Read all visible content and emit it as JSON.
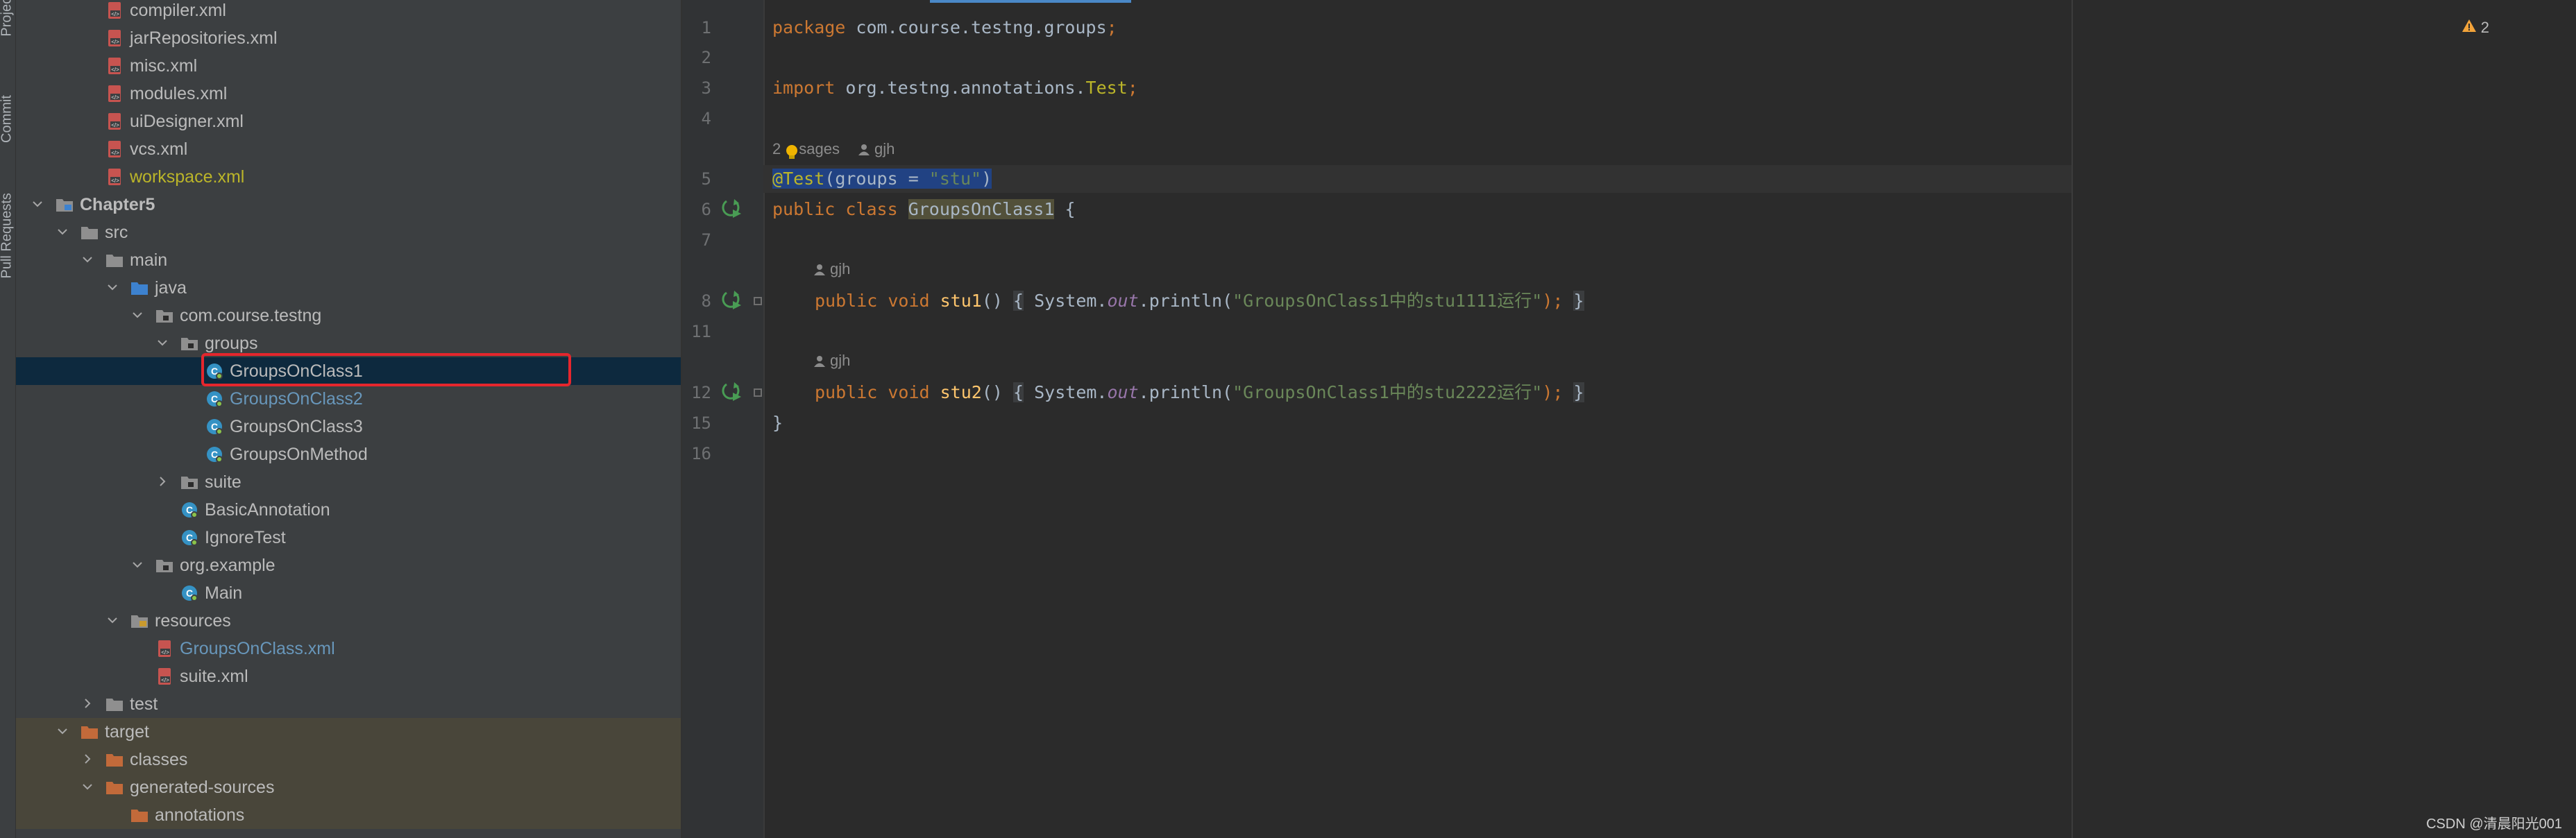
{
  "tool_strip": {
    "items": [
      {
        "label": "Project"
      },
      {
        "label": "Commit"
      },
      {
        "label": "Pull Requests"
      }
    ]
  },
  "project_tree": {
    "rows": [
      {
        "label": "compiler.xml",
        "depth": 3,
        "icon": "xml-file-icon",
        "state": "none"
      },
      {
        "label": "jarRepositories.xml",
        "depth": 3,
        "icon": "xml-file-icon",
        "state": "none"
      },
      {
        "label": "misc.xml",
        "depth": 3,
        "icon": "xml-file-icon",
        "state": "none"
      },
      {
        "label": "modules.xml",
        "depth": 3,
        "icon": "xml-file-icon",
        "state": "none"
      },
      {
        "label": "uiDesigner.xml",
        "depth": 3,
        "icon": "xml-file-icon",
        "state": "none"
      },
      {
        "label": "vcs.xml",
        "depth": 3,
        "icon": "xml-file-icon",
        "state": "none"
      },
      {
        "label": "workspace.xml",
        "depth": 3,
        "icon": "xml-file-icon",
        "state": "none",
        "tone": "gold"
      },
      {
        "label": "Chapter5",
        "depth": 1,
        "icon": "module-folder-icon",
        "state": "open",
        "bold": true
      },
      {
        "label": "src",
        "depth": 2,
        "icon": "folder-icon",
        "state": "open"
      },
      {
        "label": "main",
        "depth": 3,
        "icon": "folder-icon",
        "state": "open"
      },
      {
        "label": "java",
        "depth": 4,
        "icon": "source-folder-icon",
        "state": "open"
      },
      {
        "label": "com.course.testng",
        "depth": 5,
        "icon": "package-icon",
        "state": "open"
      },
      {
        "label": "groups",
        "depth": 6,
        "icon": "package-icon",
        "state": "open"
      },
      {
        "label": "GroupsOnClass1",
        "depth": 7,
        "icon": "java-class-icon",
        "state": "none",
        "selected": true
      },
      {
        "label": "GroupsOnClass2",
        "depth": 7,
        "icon": "java-class-icon",
        "state": "none",
        "tone": "blue"
      },
      {
        "label": "GroupsOnClass3",
        "depth": 7,
        "icon": "java-class-icon",
        "state": "none"
      },
      {
        "label": "GroupsOnMethod",
        "depth": 7,
        "icon": "java-class-icon",
        "state": "none"
      },
      {
        "label": "suite",
        "depth": 6,
        "icon": "package-icon",
        "state": "closed"
      },
      {
        "label": "BasicAnnotation",
        "depth": 6,
        "icon": "java-class-icon",
        "state": "none"
      },
      {
        "label": "IgnoreTest",
        "depth": 6,
        "icon": "java-class-icon",
        "state": "none"
      },
      {
        "label": "org.example",
        "depth": 5,
        "icon": "package-icon",
        "state": "open"
      },
      {
        "label": "Main",
        "depth": 6,
        "icon": "java-class-icon",
        "state": "none"
      },
      {
        "label": "resources",
        "depth": 4,
        "icon": "resources-folder-icon",
        "state": "open"
      },
      {
        "label": "GroupsOnClass.xml",
        "depth": 5,
        "icon": "xml-file-icon",
        "state": "none",
        "tone": "blue"
      },
      {
        "label": "suite.xml",
        "depth": 5,
        "icon": "xml-file-icon",
        "state": "none"
      },
      {
        "label": "test",
        "depth": 3,
        "icon": "folder-icon",
        "state": "closed"
      },
      {
        "label": "target",
        "depth": 2,
        "icon": "excluded-folder-icon",
        "state": "open",
        "excluded": true
      },
      {
        "label": "classes",
        "depth": 3,
        "icon": "excluded-folder-icon",
        "state": "closed",
        "excluded": true
      },
      {
        "label": "generated-sources",
        "depth": 3,
        "icon": "excluded-folder-icon",
        "state": "open",
        "excluded": true
      },
      {
        "label": "annotations",
        "depth": 4,
        "icon": "excluded-folder-icon",
        "state": "none",
        "excluded": true
      }
    ]
  },
  "editor": {
    "line1": {
      "num": "1",
      "kw": "package",
      "pkg": " com.course.testng.groups",
      "semi": ";"
    },
    "line2": {
      "num": "2"
    },
    "line3": {
      "num": "3",
      "kw": "import",
      "pkg": " org.testng.annotations.",
      "ann": "Test",
      "semi": ";"
    },
    "line4": {
      "num": "4"
    },
    "usages": {
      "count_prefix": "2",
      "count_suffix": "sages",
      "author": "gjh"
    },
    "line5": {
      "num": "5",
      "at": "@",
      "ann_name": "Test",
      "open": "(groups = ",
      "str": "\"stu\"",
      "close": ")"
    },
    "line6": {
      "num": "6",
      "kw1": "public",
      "kw2": " class ",
      "cls": "GroupsOnClass1",
      "rest": " {"
    },
    "line7": {
      "num": "7"
    },
    "author_hint1": "gjh",
    "line8": {
      "num": "8",
      "kw1": "public",
      "kw2": " void ",
      "fn": "stu1",
      "paren": "()",
      "lb": "{",
      "sys": " System.",
      "out": "out",
      "call": ".println(",
      "str": "\"GroupsOnClass1中的stu1111运行\"",
      "end": ");",
      "rb": "}"
    },
    "line11": {
      "num": "11"
    },
    "author_hint2": "gjh",
    "line12": {
      "num": "12",
      "kw1": "public",
      "kw2": " void ",
      "fn": "stu2",
      "paren": "()",
      "lb": "{",
      "sys": " System.",
      "out": "out",
      "call": ".println(",
      "str": "\"GroupsOnClass1中的stu2222运行\"",
      "end": ");",
      "rb": "}"
    },
    "line15": {
      "num": "15",
      "text": "}"
    },
    "line16": {
      "num": "16"
    },
    "warnings": "2"
  },
  "watermark": "CSDN @清晨阳光001",
  "colors": {
    "accent": "#e5262d",
    "selection": "#0d293e",
    "excluded": "#49463a"
  }
}
